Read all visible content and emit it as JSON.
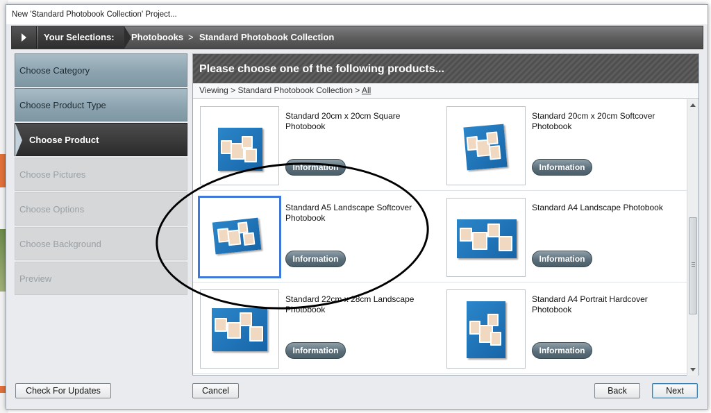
{
  "window": {
    "title": "New 'Standard Photobook Collection' Project..."
  },
  "breadcrumb": {
    "label": "Your Selections:",
    "items": [
      "Photobooks",
      "Standard Photobook Collection"
    ],
    "separator": ">"
  },
  "steps": [
    {
      "label": "Choose Category",
      "state": "done"
    },
    {
      "label": "Choose Product Type",
      "state": "done"
    },
    {
      "label": "Choose Product",
      "state": "active"
    },
    {
      "label": "Choose Pictures",
      "state": "todo"
    },
    {
      "label": "Choose Options",
      "state": "todo"
    },
    {
      "label": "Choose Background",
      "state": "todo"
    },
    {
      "label": "Preview",
      "state": "todo"
    }
  ],
  "panel": {
    "header": "Please choose one of the following products...",
    "viewing_prefix": "Viewing > Standard Photobook Collection >",
    "viewing_link": "All"
  },
  "products": [
    {
      "name": "Standard 20cm x 20cm Square Photobook",
      "info_label": "Information"
    },
    {
      "name": "Standard 20cm x 20cm Softcover Photobook",
      "info_label": "Information"
    },
    {
      "name": "Standard A5 Landscape Softcover Photobook",
      "info_label": "Information",
      "selected": true
    },
    {
      "name": "Standard A4 Landscape Photobook",
      "info_label": "Information"
    },
    {
      "name": "Standard 22cm x 28cm Landscape Photobook",
      "info_label": "Information"
    },
    {
      "name": "Standard A4 Portrait Hardcover Photobook",
      "info_label": "Information"
    }
  ],
  "buttons": {
    "check_updates": "Check For Updates",
    "cancel": "Cancel",
    "back": "Back",
    "next": "Next"
  },
  "colors": {
    "selection_border": "#3e78d8",
    "book_blue": "#1f74b8",
    "active_step": "#2b2b2b"
  }
}
